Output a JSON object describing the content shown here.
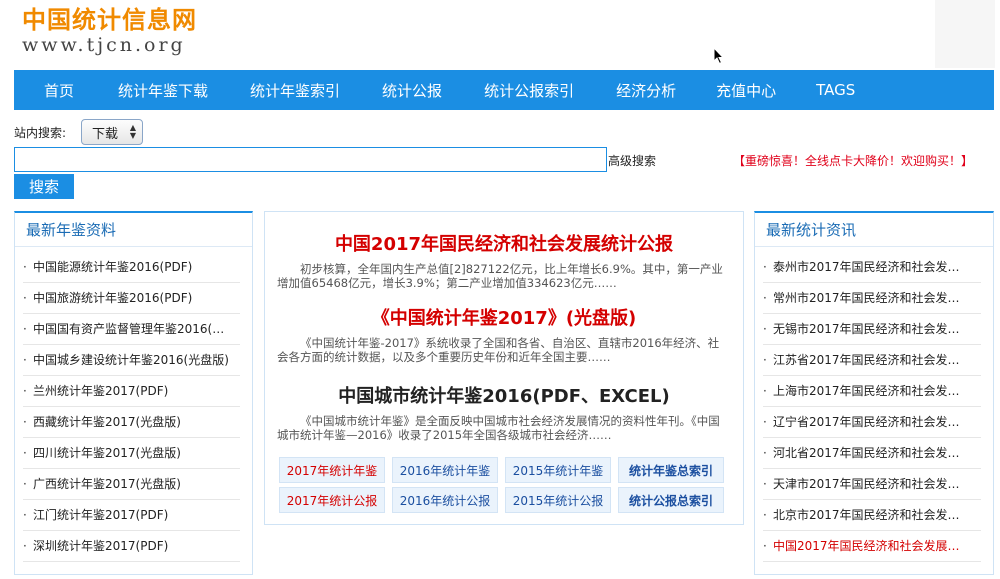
{
  "header": {
    "logo_cn": "中国统计信息网",
    "logo_url": "www.tjcn.org"
  },
  "nav": [
    "首页",
    "统计年鉴下载",
    "统计年鉴索引",
    "统计公报",
    "统计公报索引",
    "经济分析",
    "充值中心",
    "TAGS"
  ],
  "search": {
    "label": "站内搜索:",
    "select_value": "下载",
    "input_value": "",
    "advanced": "高级搜索",
    "button": "搜索",
    "promo": "【重磅惊喜！全线点卡大降价！欢迎购买！】"
  },
  "left_box": {
    "title": "最新年鉴资料",
    "items": [
      "中国能源统计年鉴2016(PDF)",
      "中国旅游统计年鉴2016(PDF)",
      "中国国有资产监督管理年鉴2016(…",
      "中国城乡建设统计年鉴2016(光盘版)",
      "兰州统计年鉴2017(PDF)",
      "西藏统计年鉴2017(光盘版)",
      "四川统计年鉴2017(光盘版)",
      "广西统计年鉴2017(光盘版)",
      "江门统计年鉴2017(PDF)",
      "深圳统计年鉴2017(PDF)"
    ]
  },
  "center": {
    "h1": "中国2017年国民经济和社会发展统计公报",
    "p1": "初步核算，全年国内生产总值[2]827122亿元，比上年增长6.9%。其中，第一产业增加值65468亿元，增长3.9%；第二产业增加值334623亿元……",
    "h2": "《中国统计年鉴2017》(光盘版)",
    "p2": "《中国统计年鉴-2017》系统收录了全国和各省、自治区、直辖市2016年经济、社会各方面的统计数据，以及多个重要历史年份和近年全国主要……",
    "h3": "中国城市统计年鉴2016(PDF、EXCEL)",
    "p3": "《中国城市统计年鉴》是全面反映中国城市社会经济发展情况的资料性年刊。《中国城市统计年鉴—2016》收录了2015年全国各级城市社会经济……",
    "links_row1": [
      "2017年统计年鉴",
      "2016年统计年鉴",
      "2015年统计年鉴",
      "统计年鉴总索引"
    ],
    "links_row2": [
      "2017年统计公报",
      "2016年统计公报",
      "2015年统计公报",
      "统计公报总索引"
    ]
  },
  "right_box": {
    "title": "最新统计资讯",
    "items": [
      "泰州市2017年国民经济和社会发…",
      "常州市2017年国民经济和社会发…",
      "无锡市2017年国民经济和社会发…",
      "江苏省2017年国民经济和社会发…",
      "上海市2017年国民经济和社会发…",
      "辽宁省2017年国民经济和社会发…",
      "河北省2017年国民经济和社会发…",
      "天津市2017年国民经济和社会发…",
      "北京市2017年国民经济和社会发…",
      "中国2017年国民经济和社会发展…"
    ]
  },
  "colors": {
    "brand_blue": "#1b8ee3",
    "logo_orange": "#f08a00",
    "headline_red": "#d40000"
  }
}
